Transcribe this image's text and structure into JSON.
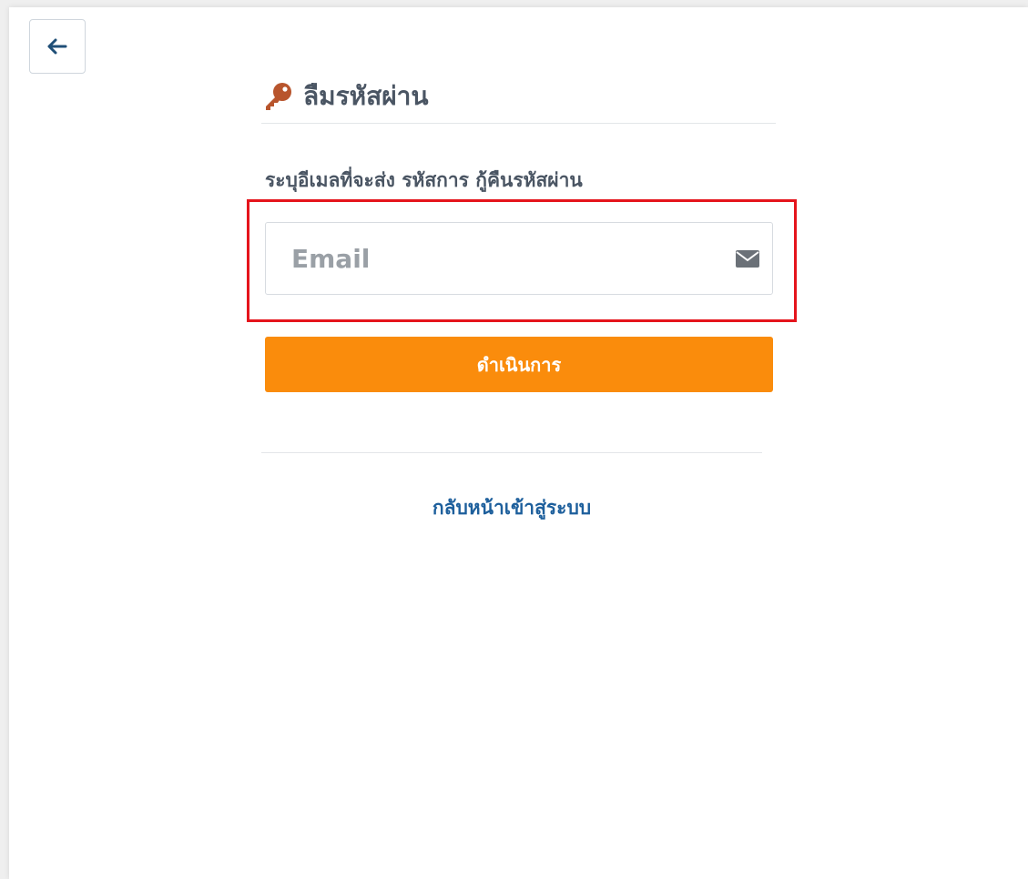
{
  "header": {
    "title": "ลืมรหัสผ่าน",
    "title_icon": "key-icon",
    "back_icon": "arrow-left-icon"
  },
  "form": {
    "instruction": "ระบุอีเมลที่จะส่ง รหัสการ กู้คืนรหัสผ่าน",
    "email_placeholder": "Email",
    "email_value": "",
    "email_icon": "envelope-icon",
    "submit_label": "ดำเนินการ"
  },
  "footer": {
    "back_to_login_label": "กลับหน้าเข้าสู่ระบบ"
  },
  "colors": {
    "accent": "#fa8c0c",
    "link": "#1d5f9c",
    "key_icon": "#b8552d",
    "highlight": "#e5141c",
    "text": "#4a5563"
  }
}
